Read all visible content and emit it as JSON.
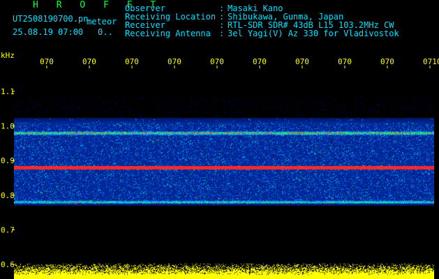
{
  "header": {
    "title": "H R O F F T",
    "filename": "UT2508190700.pn",
    "mode": "meteor",
    "datetime": "25.08.19 07:00",
    "counter": "0.."
  },
  "info": [
    {
      "key": "Observer",
      "sep": ":",
      "value": "Masaki Kano"
    },
    {
      "key": "Receiving Location",
      "sep": ":",
      "value": "Shibukawa, Gunma, Japan"
    },
    {
      "key": "Receiver",
      "sep": ":",
      "value": "RTL-SDR SDR# 43dB L15 103.2MHz CW"
    },
    {
      "key": "Receiving Antenna",
      "sep": ":",
      "value": "3el Yagi(V) Az 330 for Vladivostok"
    }
  ],
  "axis": {
    "unit": "kHz",
    "khz_ticks": [
      "1.1",
      "1.0",
      "0.9",
      "0.8",
      "0.7",
      "0.6"
    ],
    "time_ticks": [
      "070",
      "070",
      "070",
      "070",
      "070",
      "070",
      "070",
      "070",
      "070",
      "0710"
    ]
  },
  "spectrogram": {
    "colors": {
      "background": "#000000",
      "noise": "#0018a8",
      "mid": "#00c0ff",
      "hot": "#ff2020",
      "amplitude": "#ffff00",
      "grid": "#ffff00"
    },
    "echo_lines_khz": [
      0.98,
      0.88,
      0.78
    ],
    "strongest_line_khz": 0.88
  }
}
